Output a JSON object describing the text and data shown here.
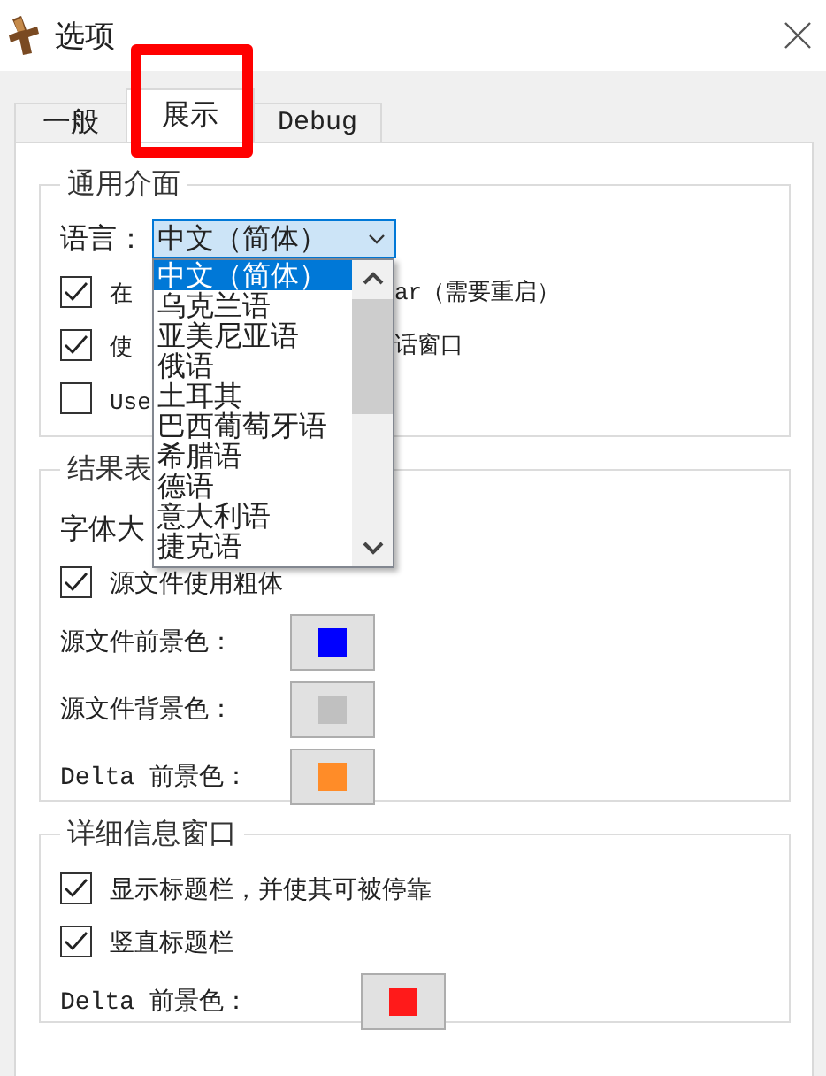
{
  "window": {
    "title": "选项"
  },
  "tabs": [
    {
      "label": "一般",
      "selected": false
    },
    {
      "label": "展示",
      "selected": true
    },
    {
      "label": "Debug",
      "selected": false
    }
  ],
  "groups": [
    {
      "title": "通用介面",
      "rows": [
        {
          "kind": "dropdown",
          "label": "语言：",
          "value": "中文（简体）",
          "expanded": true
        },
        {
          "kind": "checkbox",
          "checked": true,
          "text_before": "在",
          "text_after": "ar（需要重启）"
        },
        {
          "kind": "checkbox",
          "checked": true,
          "text_before": "使",
          "text_after": "话窗口"
        },
        {
          "kind": "checkbox",
          "checked": false,
          "text_before": "Use"
        }
      ]
    },
    {
      "title": "结果表",
      "rows": [
        {
          "kind": "text",
          "label": "字体大"
        },
        {
          "kind": "checkbox",
          "checked": true,
          "text_before": "源文件使用粗体"
        },
        {
          "kind": "color",
          "label": "源文件前景色：",
          "color": "#0000ff"
        },
        {
          "kind": "color",
          "label": "源文件背景色：",
          "color": "#c0c0c0"
        },
        {
          "kind": "color",
          "label": "Delta 前景色：",
          "color": "#ff8c28"
        }
      ]
    },
    {
      "title": "详细信息窗口",
      "rows": [
        {
          "kind": "checkbox",
          "checked": true,
          "text_before": "显示标题栏，并使其可被停靠"
        },
        {
          "kind": "checkbox",
          "checked": true,
          "text_before": "竖直标题栏"
        },
        {
          "kind": "color",
          "label": "Delta 前景色：",
          "color": "#ff1a1a"
        }
      ]
    }
  ],
  "language_list": [
    {
      "label": "中文（简体）",
      "selected": true
    },
    {
      "label": "乌克兰语",
      "selected": false
    },
    {
      "label": "亚美尼亚语",
      "selected": false
    },
    {
      "label": "俄语",
      "selected": false
    },
    {
      "label": "土耳其",
      "selected": false
    },
    {
      "label": "巴西葡萄牙语",
      "selected": false
    },
    {
      "label": "希腊语",
      "selected": false
    },
    {
      "label": "德语",
      "selected": false
    },
    {
      "label": "意大利语",
      "selected": false
    },
    {
      "label": "捷克语",
      "selected": false
    }
  ]
}
